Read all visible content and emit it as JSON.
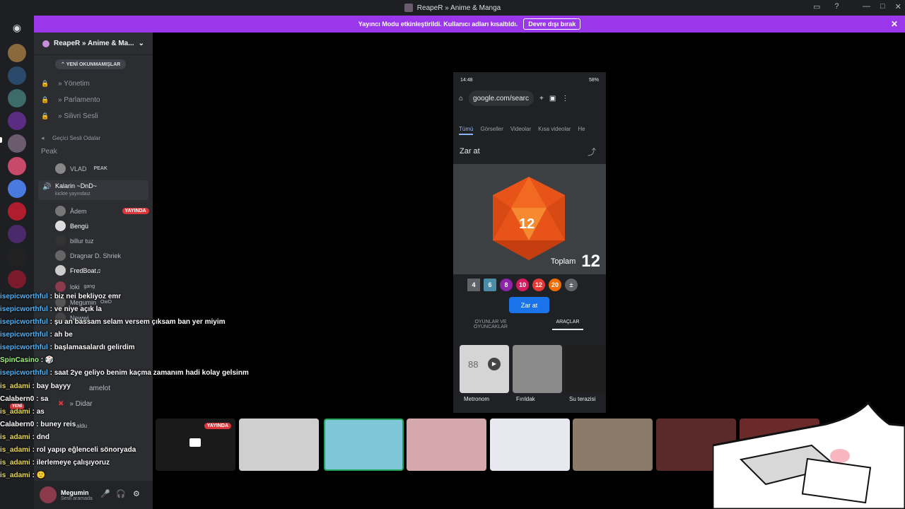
{
  "window": {
    "title": "ReapeR » Anime & Manga"
  },
  "streamer_banner": {
    "text": "Yayıncı Modu etkinleştirildi. Kullanıcı adları kısaltıldı.",
    "button": "Devre dışı bırak"
  },
  "server": {
    "name": "ReapeR » Anime & Ma..."
  },
  "channels": {
    "unread_pill": "YENİ OKUNMAMIŞLAR",
    "items": [
      "» Yönetim",
      "» Parlamento",
      "» Silivri Sesli"
    ],
    "category": "Geçici Sesli Odalar",
    "peak": "Peak",
    "peak_user": "VLAD",
    "peak_badge": "PEAK",
    "active_voice": "Kalarin ~DnD~",
    "active_sub": "kickte yayındaız",
    "voice_users": [
      "Âdem",
      "Bengü",
      "billur tuz",
      "Dragnar D. Shriek",
      "FredBoat♫",
      "loki",
      "Megumin"
    ],
    "live_badge": "YAYINDA",
    "loki_tag": "gang",
    "megumin_tag": "OwO",
    "bottom_items": [
      "Newwi",
      "amelot",
      "» Didar"
    ],
    "bottom_label": "aldu",
    "yeni_badge": "YENİ"
  },
  "chat_overlay": [
    {
      "name": "isepicworthful",
      "msg": "biz nei bekliyoz emr"
    },
    {
      "name": "isepicworthful",
      "msg": "ve niye açık la"
    },
    {
      "name": "isepicworthful",
      "msg": "şu an bassam selam versem çıksam ban yer miyim"
    },
    {
      "name": "isepicworthful",
      "msg": "ah be"
    },
    {
      "name": "isepicworthful",
      "msg": "başlamasalardı gelirdim"
    },
    {
      "name": "SpinCasino",
      "msg": "🎲"
    },
    {
      "name": "isepicworthful",
      "msg": "saat 2ye geliyo benim kaçma zamanım hadi kolay gelsinm"
    },
    {
      "name": "is_adami",
      "msg": "bay bayyy"
    },
    {
      "name": "Calabern0",
      "msg": "sa"
    },
    {
      "name": "is_adami",
      "msg": "as"
    },
    {
      "name": "Calabern0",
      "msg": "buney reis"
    },
    {
      "name": "is_adami",
      "msg": "dnd"
    },
    {
      "name": "is_adami",
      "msg": "rol yapıp eğlenceli sönoryada"
    },
    {
      "name": "is_adami",
      "msg": "ilerlemeye çalışıyoruz"
    },
    {
      "name": "is_adami",
      "msg": "🙂"
    }
  ],
  "user_panel": {
    "name": "Megumin",
    "status": "Sesli aramada"
  },
  "phone": {
    "time": "14:48",
    "battery": "58%",
    "url": "google.com/searc",
    "tabs": [
      "Tümü",
      "Görseller",
      "Videolar",
      "Kısa videolar",
      "He"
    ],
    "card_title": "Zar at",
    "die_value": "12",
    "total_label": "Toplam",
    "total_value": "12",
    "dice_options": [
      "4",
      "6",
      "8",
      "10",
      "12",
      "20",
      "±"
    ],
    "roll_button": "Zar at",
    "bottom_tabs": [
      "OYUNLAR VE OYUNCAKLAR",
      "ARAÇLAR"
    ],
    "tools": [
      "Metronom",
      "Fırıldak",
      "Su terazisi"
    ],
    "metronome_value": "88"
  },
  "stream_tiles": {
    "live_badge": "YAYINDA"
  }
}
